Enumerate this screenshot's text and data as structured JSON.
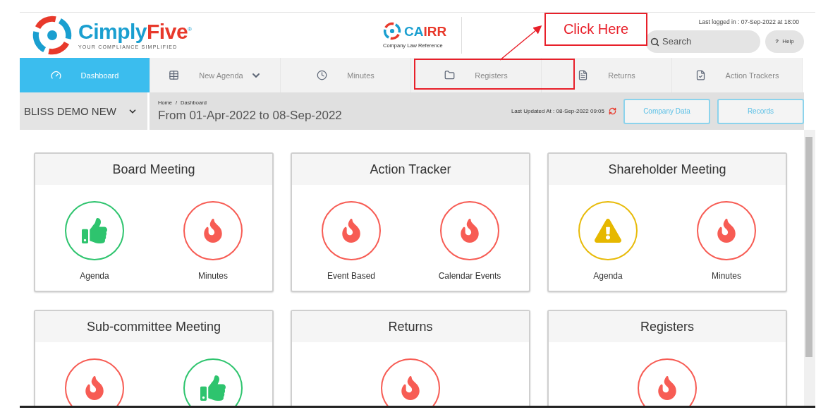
{
  "header": {
    "logo": {
      "name_first": "Cimply",
      "name_second": "Five",
      "registered": "®",
      "tagline": "YOUR COMPLIANCE SIMPLIFIED"
    },
    "cairr": {
      "name_first": "CA",
      "name_second": "IRR",
      "tagline": "Company Law Reference"
    },
    "last_logged_in": "Last logged in : 07-Sep-2022 at 18:00",
    "search": {
      "placeholder": "Search"
    },
    "help": {
      "mark": "?",
      "label": "Help"
    }
  },
  "nav": {
    "tabs": [
      {
        "label": "Dashboard",
        "kind": "gauge",
        "selected": true,
        "dropdown": false
      },
      {
        "label": "New Agenda",
        "kind": "table",
        "selected": false,
        "dropdown": true
      },
      {
        "label": "Minutes",
        "kind": "clock",
        "selected": false,
        "dropdown": false
      },
      {
        "label": "Registers",
        "kind": "folder",
        "selected": false,
        "dropdown": false
      },
      {
        "label": "Returns",
        "kind": "file",
        "selected": false,
        "dropdown": false
      },
      {
        "label": "Action Trackers",
        "kind": "check",
        "selected": false,
        "dropdown": false
      }
    ]
  },
  "subbar": {
    "company": "BLISS DEMO NEW",
    "breadcrumb": [
      "Home",
      "Dashboard"
    ],
    "separator": "/",
    "period": "From 01-Apr-2022 to 08-Sep-2022",
    "last_updated": "Last Updated At : 08-Sep-2022 09:05",
    "buttons": [
      "Company Data",
      "Records"
    ]
  },
  "cards": [
    {
      "title": "Board Meeting",
      "items": [
        {
          "kind": "ok",
          "label": "Agenda"
        },
        {
          "kind": "overdue",
          "label": "Minutes"
        }
      ]
    },
    {
      "title": "Action Tracker",
      "items": [
        {
          "kind": "overdue",
          "label": "Event Based"
        },
        {
          "kind": "overdue",
          "label": "Calendar Events"
        }
      ]
    },
    {
      "title": "Shareholder Meeting",
      "items": [
        {
          "kind": "warning",
          "label": "Agenda"
        },
        {
          "kind": "overdue",
          "label": "Minutes"
        }
      ]
    },
    {
      "title": "Sub-committee Meeting",
      "items": [
        {
          "kind": "overdue"
        },
        {
          "kind": "ok"
        }
      ]
    },
    {
      "title": "Returns",
      "items": [
        {
          "kind": "overdue"
        }
      ]
    },
    {
      "title": "Registers",
      "items": [
        {
          "kind": "overdue"
        }
      ]
    }
  ],
  "annotation": {
    "callout": "Click Here"
  }
}
